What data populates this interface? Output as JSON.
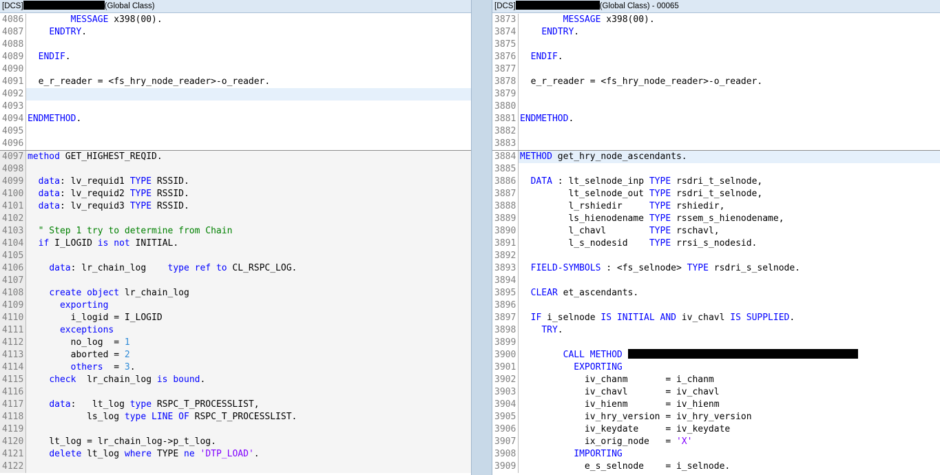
{
  "left": {
    "title_prefix": "[DCS]",
    "title_suffix": "(Global Class)",
    "lines": [
      {
        "n": "4086",
        "spans": [
          [
            "",
            "        "
          ],
          [
            "kw",
            "MESSAGE"
          ],
          [
            "",
            " x398("
          ],
          [
            "",
            "00"
          ],
          [
            "",
            ")."
          ]
        ]
      },
      {
        "n": "4087",
        "spans": [
          [
            "",
            "    "
          ],
          [
            "kw",
            "ENDTRY"
          ],
          [
            "",
            "."
          ]
        ]
      },
      {
        "n": "4088",
        "spans": []
      },
      {
        "n": "4089",
        "spans": [
          [
            "",
            "  "
          ],
          [
            "kw",
            "ENDIF"
          ],
          [
            "",
            "."
          ]
        ]
      },
      {
        "n": "4090",
        "spans": []
      },
      {
        "n": "4091",
        "spans": [
          [
            "",
            "  e_r_reader = <fs_hry_node_reader>-o_reader."
          ]
        ]
      },
      {
        "n": "4092",
        "spans": [],
        "hl": true
      },
      {
        "n": "4093",
        "spans": []
      },
      {
        "n": "4094",
        "spans": [
          [
            "kw",
            "ENDMETHOD"
          ],
          [
            "",
            "."
          ]
        ]
      },
      {
        "n": "4095",
        "spans": []
      },
      {
        "n": "4096",
        "spans": []
      },
      {
        "n": "4097",
        "sep": true,
        "gray": true,
        "spans": [
          [
            "kw",
            "method"
          ],
          [
            "",
            " GET_HIGHEST_REQID."
          ]
        ]
      },
      {
        "n": "4098",
        "gray": true,
        "spans": []
      },
      {
        "n": "4099",
        "gray": true,
        "spans": [
          [
            "",
            "  "
          ],
          [
            "kw",
            "data"
          ],
          [
            "",
            ": lv_requid1 "
          ],
          [
            "kw",
            "TYPE"
          ],
          [
            "",
            " RSSID."
          ]
        ]
      },
      {
        "n": "4100",
        "gray": true,
        "spans": [
          [
            "",
            "  "
          ],
          [
            "kw",
            "data"
          ],
          [
            "",
            ": lv_requid2 "
          ],
          [
            "kw",
            "TYPE"
          ],
          [
            "",
            " RSSID."
          ]
        ]
      },
      {
        "n": "4101",
        "gray": true,
        "spans": [
          [
            "",
            "  "
          ],
          [
            "kw",
            "data"
          ],
          [
            "",
            ": lv_requid3 "
          ],
          [
            "kw",
            "TYPE"
          ],
          [
            "",
            " RSSID."
          ]
        ]
      },
      {
        "n": "4102",
        "gray": true,
        "spans": []
      },
      {
        "n": "4103",
        "gray": true,
        "spans": [
          [
            "",
            "  "
          ],
          [
            "cm",
            "\" Step 1 try to determine from Chain"
          ]
        ]
      },
      {
        "n": "4104",
        "gray": true,
        "spans": [
          [
            "",
            "  "
          ],
          [
            "kw",
            "if"
          ],
          [
            "",
            " I_LOGID "
          ],
          [
            "kw",
            "is not"
          ],
          [
            "",
            " INITIAL."
          ]
        ]
      },
      {
        "n": "4105",
        "gray": true,
        "spans": []
      },
      {
        "n": "4106",
        "gray": true,
        "spans": [
          [
            "",
            "    "
          ],
          [
            "kw",
            "data"
          ],
          [
            "",
            ": lr_chain_log    "
          ],
          [
            "kw",
            "type ref to"
          ],
          [
            "",
            " CL_RSPC_LOG."
          ]
        ]
      },
      {
        "n": "4107",
        "gray": true,
        "spans": []
      },
      {
        "n": "4108",
        "gray": true,
        "spans": [
          [
            "",
            "    "
          ],
          [
            "kw",
            "create object"
          ],
          [
            "",
            " lr_chain_log"
          ]
        ]
      },
      {
        "n": "4109",
        "gray": true,
        "spans": [
          [
            "",
            "      "
          ],
          [
            "kw",
            "exporting"
          ]
        ]
      },
      {
        "n": "4110",
        "gray": true,
        "spans": [
          [
            "",
            "        i_logid = I_LOGID"
          ]
        ]
      },
      {
        "n": "4111",
        "gray": true,
        "spans": [
          [
            "",
            "      "
          ],
          [
            "kw",
            "exceptions"
          ]
        ]
      },
      {
        "n": "4112",
        "gray": true,
        "spans": [
          [
            "",
            "        no_log  = "
          ],
          [
            "num",
            "1"
          ]
        ]
      },
      {
        "n": "4113",
        "gray": true,
        "spans": [
          [
            "",
            "        aborted = "
          ],
          [
            "num",
            "2"
          ]
        ]
      },
      {
        "n": "4114",
        "gray": true,
        "spans": [
          [
            "",
            "        "
          ],
          [
            "kw",
            "others"
          ],
          [
            "",
            "  = "
          ],
          [
            "num",
            "3"
          ],
          [
            "",
            "."
          ]
        ]
      },
      {
        "n": "4115",
        "gray": true,
        "spans": [
          [
            "",
            "    "
          ],
          [
            "kw",
            "check"
          ],
          [
            "",
            "  lr_chain_log "
          ],
          [
            "kw",
            "is bound"
          ],
          [
            "",
            "."
          ]
        ]
      },
      {
        "n": "4116",
        "gray": true,
        "spans": []
      },
      {
        "n": "4117",
        "gray": true,
        "spans": [
          [
            "",
            "    "
          ],
          [
            "kw",
            "data"
          ],
          [
            "",
            ":   lt_log "
          ],
          [
            "kw",
            "type"
          ],
          [
            "",
            " RSPC_T_PROCESSLIST,"
          ]
        ]
      },
      {
        "n": "4118",
        "gray": true,
        "spans": [
          [
            "",
            "           ls_log "
          ],
          [
            "kw",
            "type"
          ],
          [
            "",
            " "
          ],
          [
            "kw",
            "LINE OF"
          ],
          [
            "",
            " RSPC_T_PROCESSLIST."
          ]
        ]
      },
      {
        "n": "4119",
        "gray": true,
        "spans": []
      },
      {
        "n": "4120",
        "gray": true,
        "spans": [
          [
            "",
            "    lt_log = lr_chain_log->p_t_log."
          ]
        ]
      },
      {
        "n": "4121",
        "gray": true,
        "spans": [
          [
            "",
            "    "
          ],
          [
            "kw",
            "delete"
          ],
          [
            "",
            " lt_log "
          ],
          [
            "kw",
            "where"
          ],
          [
            "",
            " TYPE "
          ],
          [
            "kw",
            "ne"
          ],
          [
            "",
            " "
          ],
          [
            "str",
            "'DTP_LOAD'"
          ],
          [
            "",
            "."
          ]
        ]
      },
      {
        "n": "4122",
        "gray": true,
        "spans": []
      }
    ]
  },
  "right": {
    "title_prefix": "[DCS]",
    "title_suffix": "(Global Class) - 00065",
    "lines": [
      {
        "n": "3873",
        "spans": [
          [
            "",
            "        "
          ],
          [
            "kw",
            "MESSAGE"
          ],
          [
            "",
            " x398("
          ],
          [
            "",
            "00"
          ],
          [
            "",
            ")."
          ]
        ]
      },
      {
        "n": "3874",
        "spans": [
          [
            "",
            "    "
          ],
          [
            "kw",
            "ENDTRY"
          ],
          [
            "",
            "."
          ]
        ]
      },
      {
        "n": "3875",
        "spans": []
      },
      {
        "n": "3876",
        "spans": [
          [
            "",
            "  "
          ],
          [
            "kw",
            "ENDIF"
          ],
          [
            "",
            "."
          ]
        ]
      },
      {
        "n": "3877",
        "spans": []
      },
      {
        "n": "3878",
        "spans": [
          [
            "",
            "  e_r_reader = <fs_hry_node_reader>-o_reader."
          ]
        ]
      },
      {
        "n": "3879",
        "spans": []
      },
      {
        "n": "3880",
        "spans": []
      },
      {
        "n": "3881",
        "spans": [
          [
            "kw",
            "ENDMETHOD"
          ],
          [
            "",
            "."
          ]
        ]
      },
      {
        "n": "3882",
        "spans": []
      },
      {
        "n": "3883",
        "spans": []
      },
      {
        "n": "3884",
        "sep": true,
        "hl": true,
        "spans": [
          [
            "kw",
            "METHOD"
          ],
          [
            "",
            " get_hry_node_ascendants."
          ]
        ]
      },
      {
        "n": "3885",
        "spans": []
      },
      {
        "n": "3886",
        "spans": [
          [
            "",
            "  "
          ],
          [
            "kw",
            "DATA"
          ],
          [
            "",
            " : lt_selnode_inp "
          ],
          [
            "kw",
            "TYPE"
          ],
          [
            "",
            " rsdri_t_selnode,"
          ]
        ]
      },
      {
        "n": "3887",
        "spans": [
          [
            "",
            "         lt_selnode_out "
          ],
          [
            "kw",
            "TYPE"
          ],
          [
            "",
            " rsdri_t_selnode,"
          ]
        ]
      },
      {
        "n": "3888",
        "spans": [
          [
            "",
            "         l_rshiedir     "
          ],
          [
            "kw",
            "TYPE"
          ],
          [
            "",
            " rshiedir,"
          ]
        ]
      },
      {
        "n": "3889",
        "spans": [
          [
            "",
            "         ls_hienodename "
          ],
          [
            "kw",
            "TYPE"
          ],
          [
            "",
            " rssem_s_hienodename,"
          ]
        ]
      },
      {
        "n": "3890",
        "spans": [
          [
            "",
            "         l_chavl        "
          ],
          [
            "kw",
            "TYPE"
          ],
          [
            "",
            " rschavl,"
          ]
        ]
      },
      {
        "n": "3891",
        "spans": [
          [
            "",
            "         l_s_nodesid    "
          ],
          [
            "kw",
            "TYPE"
          ],
          [
            "",
            " rrsi_s_nodesid."
          ]
        ]
      },
      {
        "n": "3892",
        "spans": []
      },
      {
        "n": "3893",
        "spans": [
          [
            "",
            "  "
          ],
          [
            "kw",
            "FIELD-SYMBOLS"
          ],
          [
            "",
            " : <fs_selnode> "
          ],
          [
            "kw",
            "TYPE"
          ],
          [
            "",
            " rsdri_s_selnode."
          ]
        ]
      },
      {
        "n": "3894",
        "spans": []
      },
      {
        "n": "3895",
        "spans": [
          [
            "",
            "  "
          ],
          [
            "kw",
            "CLEAR"
          ],
          [
            "",
            " et_ascendants."
          ]
        ]
      },
      {
        "n": "3896",
        "spans": []
      },
      {
        "n": "3897",
        "spans": [
          [
            "",
            "  "
          ],
          [
            "kw",
            "IF"
          ],
          [
            "",
            " i_selnode "
          ],
          [
            "kw",
            "IS INITIAL AND"
          ],
          [
            "",
            " iv_chavl "
          ],
          [
            "kw",
            "IS SUPPLIED"
          ],
          [
            "",
            "."
          ]
        ]
      },
      {
        "n": "3898",
        "spans": [
          [
            "",
            "    "
          ],
          [
            "kw",
            "TRY"
          ],
          [
            "",
            "."
          ]
        ]
      },
      {
        "n": "3899",
        "spans": []
      },
      {
        "n": "3900",
        "spans": [
          [
            "",
            "        "
          ],
          [
            "kw",
            "CALL METHOD"
          ],
          [
            "",
            " "
          ],
          [
            "redact",
            ""
          ]
        ]
      },
      {
        "n": "3901",
        "spans": [
          [
            "",
            "          "
          ],
          [
            "kw",
            "EXPORTING"
          ]
        ]
      },
      {
        "n": "3902",
        "spans": [
          [
            "",
            "            iv_chanm       = i_chanm"
          ]
        ]
      },
      {
        "n": "3903",
        "spans": [
          [
            "",
            "            iv_chavl       = iv_chavl"
          ]
        ]
      },
      {
        "n": "3904",
        "spans": [
          [
            "",
            "            iv_hienm       = iv_hienm"
          ]
        ]
      },
      {
        "n": "3905",
        "spans": [
          [
            "",
            "            iv_hry_version = iv_hry_version"
          ]
        ]
      },
      {
        "n": "3906",
        "spans": [
          [
            "",
            "            iv_keydate     = iv_keydate"
          ]
        ]
      },
      {
        "n": "3907",
        "spans": [
          [
            "",
            "            ix_orig_node   = "
          ],
          [
            "str",
            "'X'"
          ]
        ]
      },
      {
        "n": "3908",
        "spans": [
          [
            "",
            "          "
          ],
          [
            "kw",
            "IMPORTING"
          ]
        ]
      },
      {
        "n": "3909",
        "spans": [
          [
            "",
            "            e_s_selnode    = i_selnode."
          ]
        ]
      }
    ]
  }
}
